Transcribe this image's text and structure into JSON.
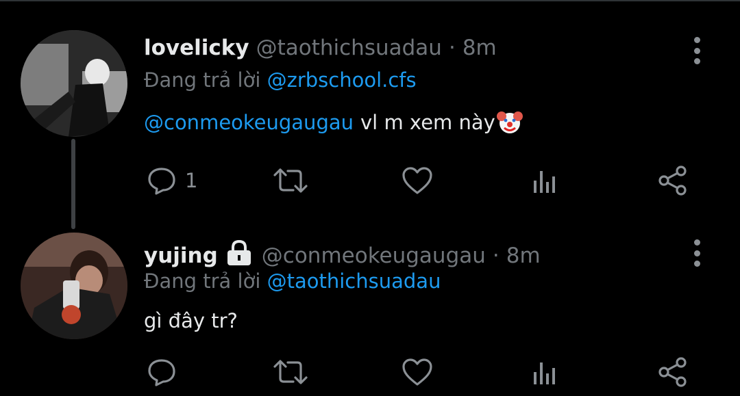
{
  "colors": {
    "background": "#000000",
    "accent": "#1d9bf0",
    "muted": "#71767b",
    "text": "#e7e9ea",
    "icon": "#8b9095"
  },
  "tweets": [
    {
      "name": "lovelicky",
      "handle": "@taothichsuadau",
      "dot": "·",
      "time": "8m",
      "replying_label": "Đang trả lời",
      "replying_to": "@zrbschool.cfs",
      "mention": "@conmeokeugaugau",
      "text": "vl m xem này",
      "emoji": "clown-face",
      "reply_count": "1",
      "locked": false
    },
    {
      "name": "yujing",
      "handle": "@conmeokeugaugau",
      "dot": "·",
      "time": "8m",
      "replying_label": "Đang trả lời",
      "replying_to": "@taothichsuadau",
      "text": "gì đây tr?",
      "reply_count": "",
      "locked": true
    }
  ],
  "icons": {
    "reply": "reply-icon",
    "retweet": "retweet-icon",
    "like": "heart-icon",
    "views": "analytics-icon",
    "share": "share-icon",
    "more": "more-vertical-icon",
    "lock": "lock-icon"
  }
}
